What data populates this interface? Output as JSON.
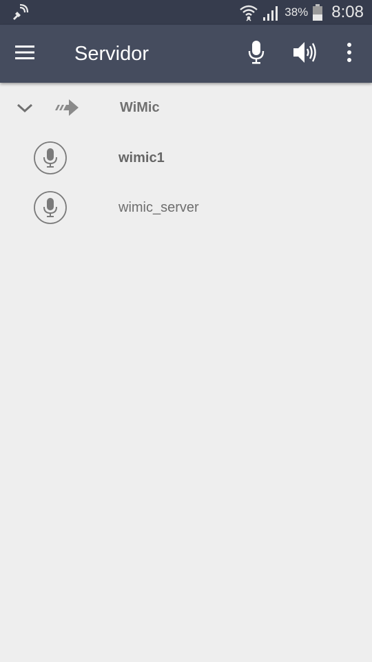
{
  "status_bar": {
    "left_icon": "satellite-signal-icon",
    "wifi_icon": "wifi-icon",
    "signal_icon": "cell-signal-icon",
    "battery_percent": "38%",
    "battery_icon": "battery-icon",
    "time": "8:08"
  },
  "app_bar": {
    "menu_icon": "hamburger-menu-icon",
    "title": "Servidor",
    "mic_icon": "microphone-icon",
    "speaker_icon": "speaker-volume-icon",
    "overflow_icon": "more-vert-icon",
    "background": "#454c5e"
  },
  "tree": {
    "group": {
      "expand_icon": "chevron-down-icon",
      "type_icon": "forward-arrow-icon",
      "label": "WiMic"
    },
    "items": [
      {
        "label": "wimic1",
        "icon": "microphone-circle-icon",
        "bold": true
      },
      {
        "label": "wimic_server",
        "icon": "microphone-circle-icon",
        "bold": false
      }
    ]
  }
}
